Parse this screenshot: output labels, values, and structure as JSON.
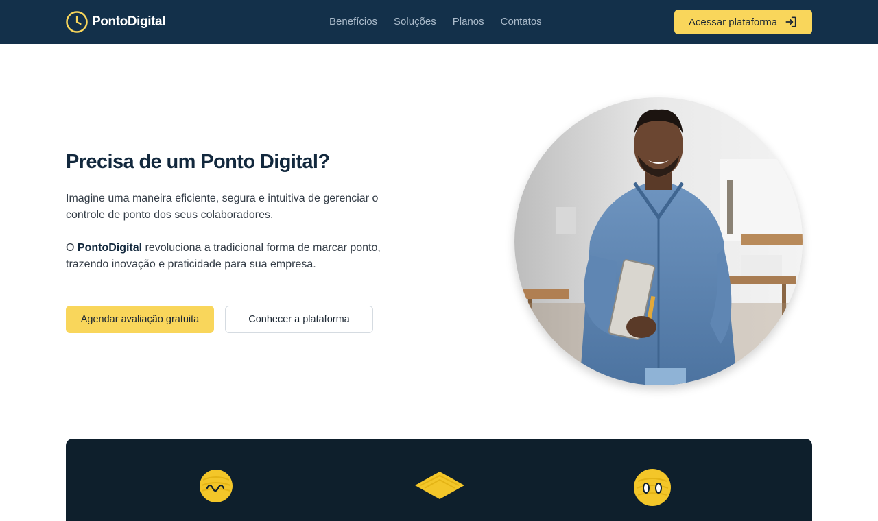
{
  "brand": {
    "name": "PontoDigital"
  },
  "nav": {
    "links": [
      "Benefícios",
      "Soluções",
      "Planos",
      "Contatos"
    ],
    "cta_label": "Acessar plataforma"
  },
  "hero": {
    "title": "Precisa de um Ponto Digital?",
    "paragraph1": "Imagine uma maneira eficiente, segura e intuitiva de gerenciar o controle de ponto dos seus colaboradores.",
    "paragraph2_prefix": "O ",
    "paragraph2_brand": "PontoDigital",
    "paragraph2_suffix": " revoluciona a tradicional forma de marcar ponto, trazendo inovação e praticidade para sua empresa.",
    "primary_button": "Agendar avaliação gratuita",
    "secondary_button": "Conhecer a plataforma"
  },
  "features": {
    "icons": [
      "scribble-face-icon",
      "scribble-book-icon",
      "scribble-smiley-icon"
    ]
  },
  "colors": {
    "navbar": "#13304a",
    "accent": "#f9d65b",
    "panel": "#0e1f2c",
    "title": "#12283d"
  }
}
